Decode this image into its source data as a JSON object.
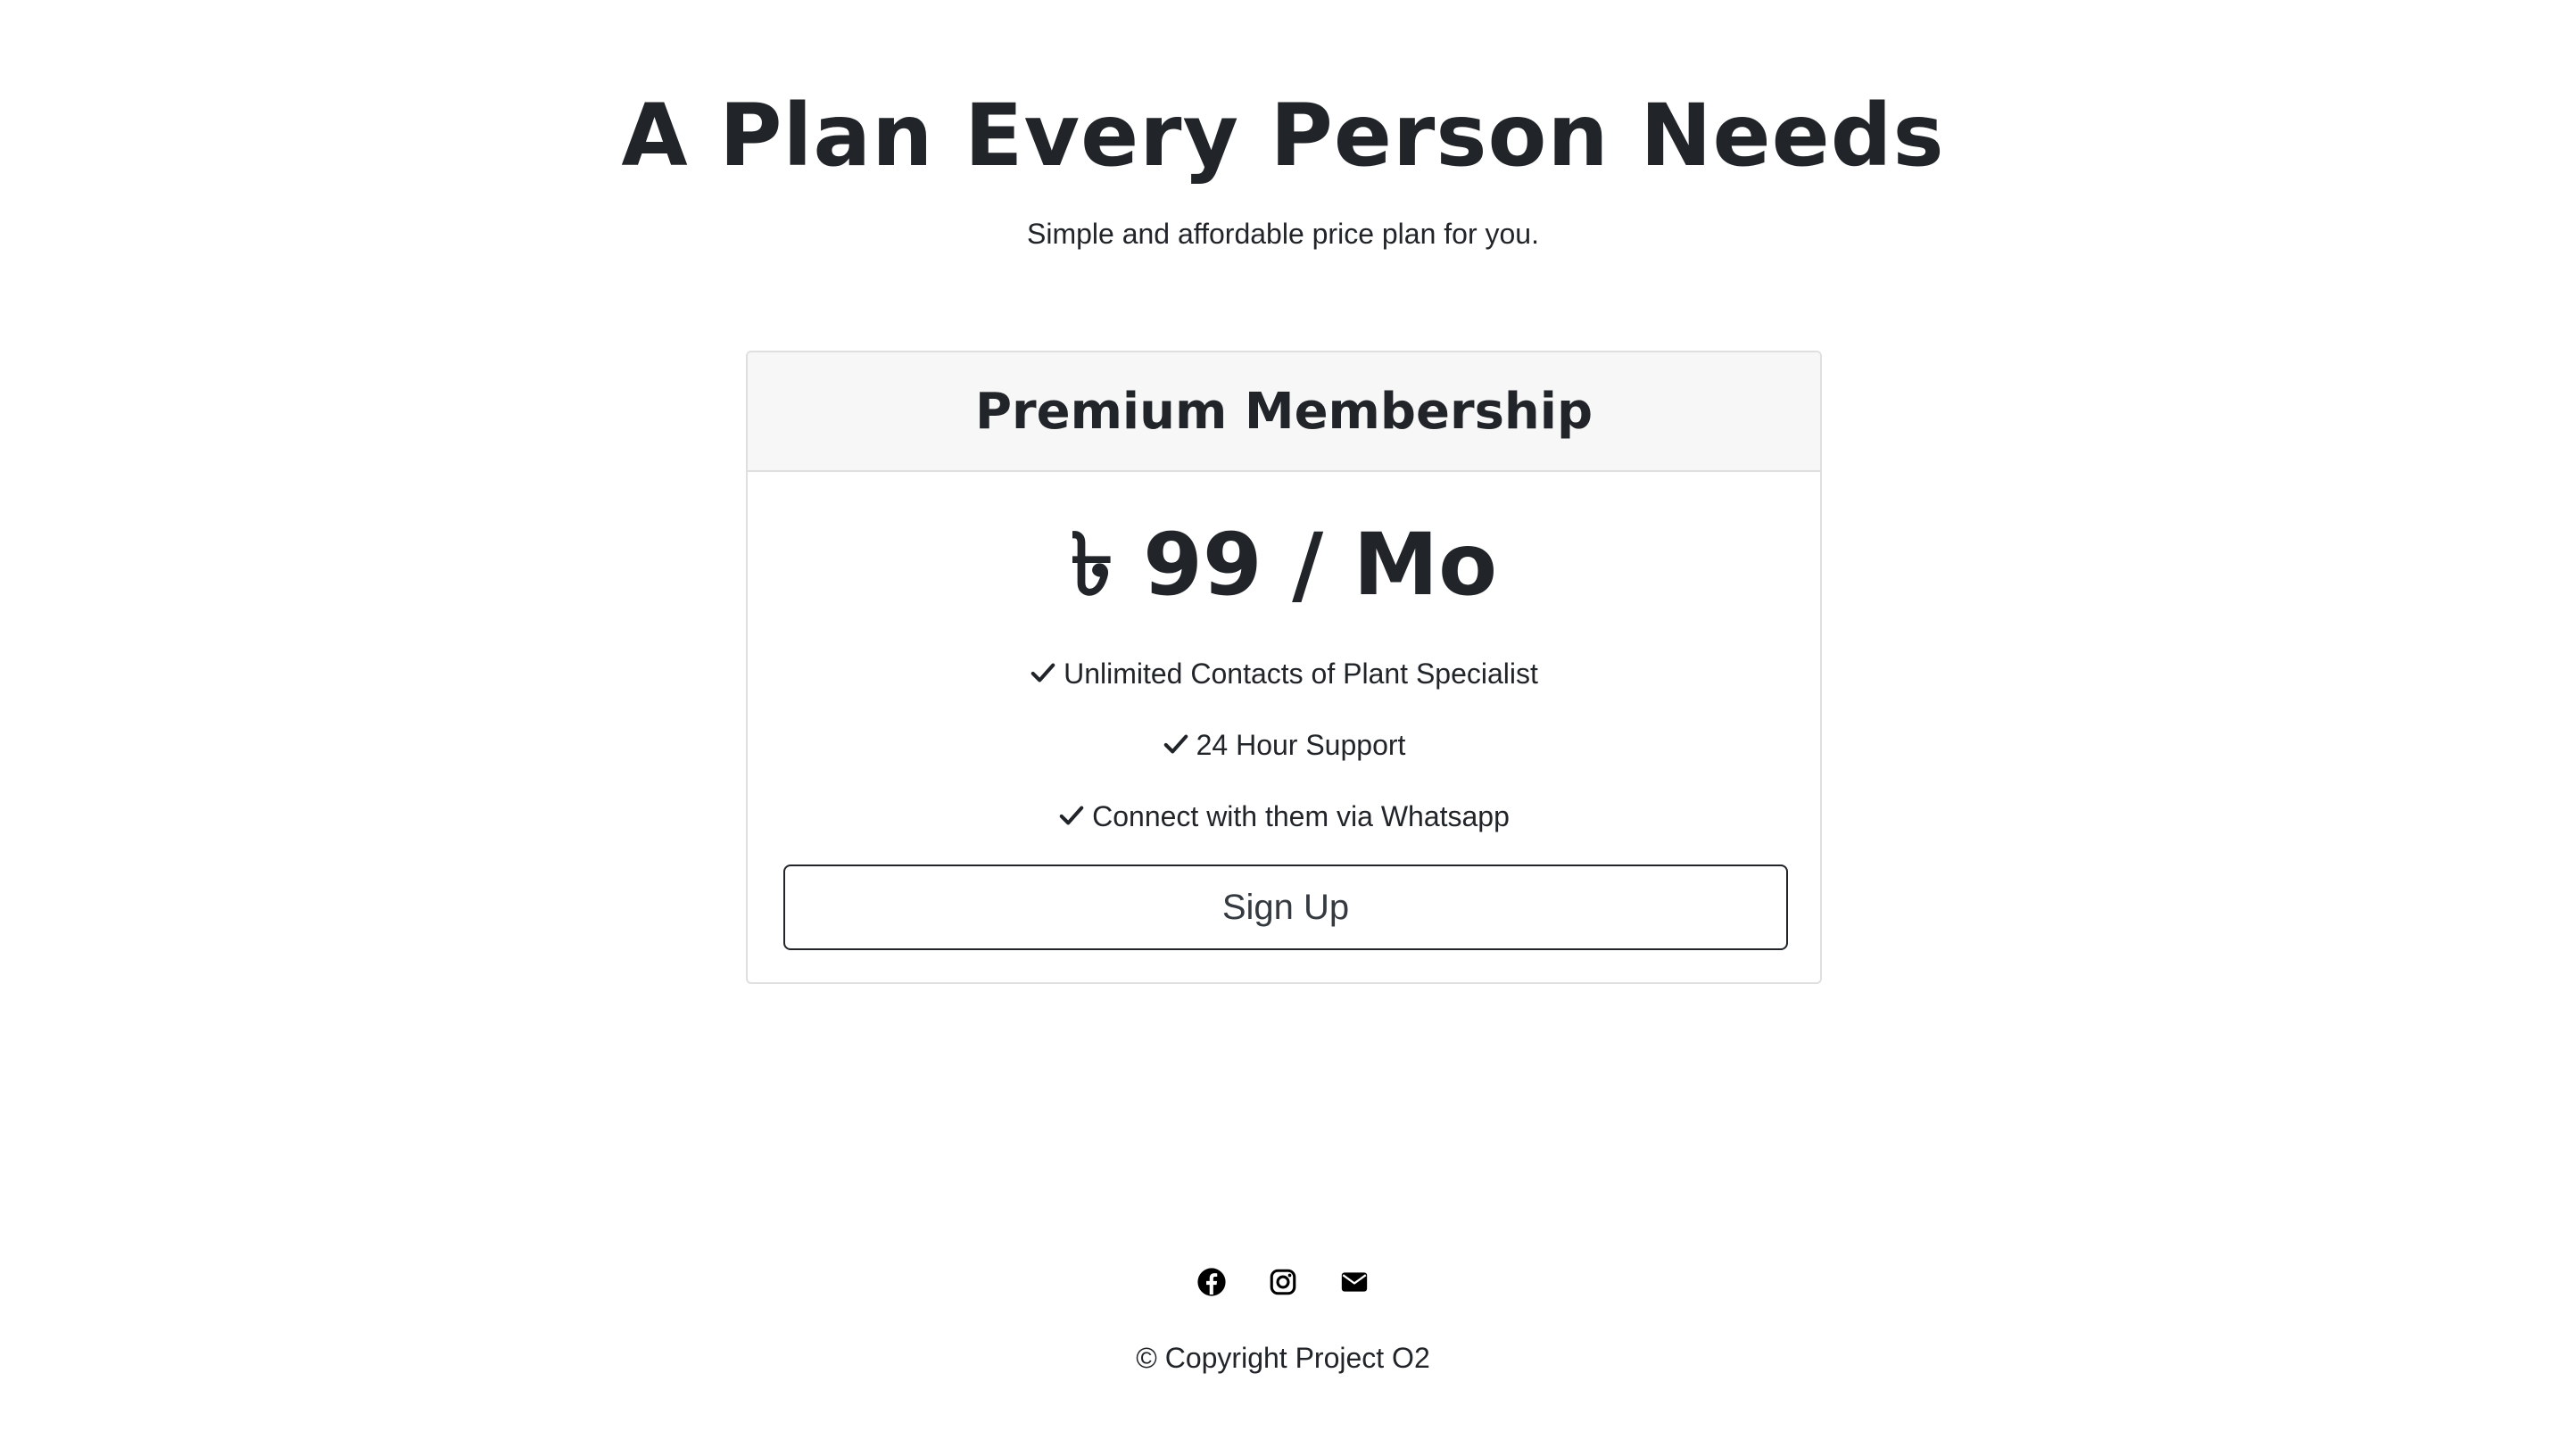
{
  "hero": {
    "title": "A Plan Every Person Needs",
    "subtitle": "Simple and affordable price plan for you."
  },
  "plan": {
    "name": "Premium Membership",
    "price": "৳ 99 / Mo",
    "features": [
      "Unlimited Contacts of Plant Specialist",
      "24 Hour Support",
      "Connect with them via Whatsapp"
    ],
    "cta_label": "Sign Up"
  },
  "footer": {
    "social_icons": [
      "facebook-icon",
      "instagram-icon",
      "email-icon"
    ],
    "copyright": "© Copyright Project O2"
  },
  "colors": {
    "text": "#212529",
    "card_header_bg": "#f7f7f7",
    "border": "#dfdfdf"
  }
}
